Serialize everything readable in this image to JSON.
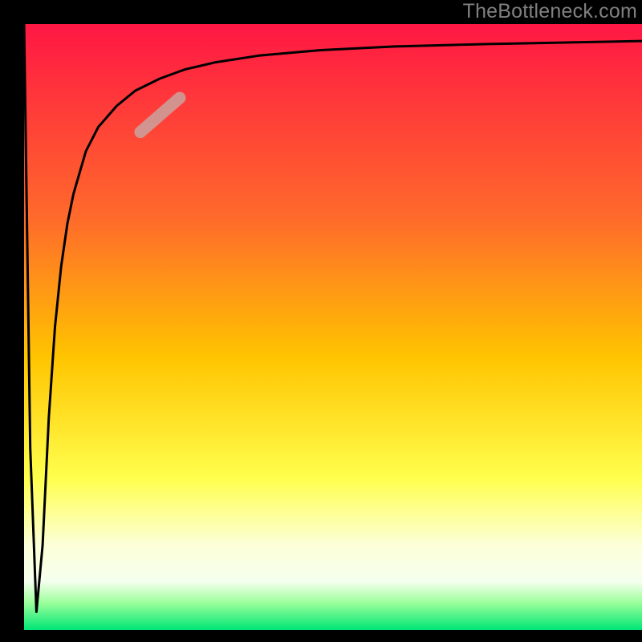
{
  "watermark": "TheBottleneck.com",
  "chart_data": {
    "type": "line",
    "title": "",
    "xlabel": "",
    "ylabel": "",
    "xlim": [
      0,
      100
    ],
    "ylim": [
      0,
      100
    ],
    "gradient_stops": [
      {
        "offset": 0,
        "color": "#ff1744"
      },
      {
        "offset": 0.32,
        "color": "#ff6a2b"
      },
      {
        "offset": 0.55,
        "color": "#ffc400"
      },
      {
        "offset": 0.75,
        "color": "#ffff4d"
      },
      {
        "offset": 0.86,
        "color": "#fcffd8"
      },
      {
        "offset": 0.92,
        "color": "#f5ffee"
      },
      {
        "offset": 0.955,
        "color": "#9bff9b"
      },
      {
        "offset": 1.0,
        "color": "#00e676"
      }
    ],
    "series": [
      {
        "name": "curve",
        "x": [
          0,
          1,
          2,
          3,
          4,
          5,
          6,
          7,
          8,
          10,
          12,
          15,
          18,
          22,
          26,
          31,
          38,
          48,
          60,
          75,
          90,
          100
        ],
        "y": [
          100,
          30,
          3,
          14,
          35,
          50,
          60,
          67,
          72,
          79,
          83,
          86.5,
          89,
          91,
          92.5,
          93.7,
          94.8,
          95.7,
          96.3,
          96.7,
          97.0,
          97.2
        ]
      }
    ],
    "highlight": {
      "center_x": 22,
      "center_y": 85,
      "angle_deg": 41,
      "length": 80,
      "width": 15,
      "color": "#caa29e",
      "opacity": 0.85
    },
    "stroke": {
      "color": "#000000",
      "width": 3
    }
  }
}
